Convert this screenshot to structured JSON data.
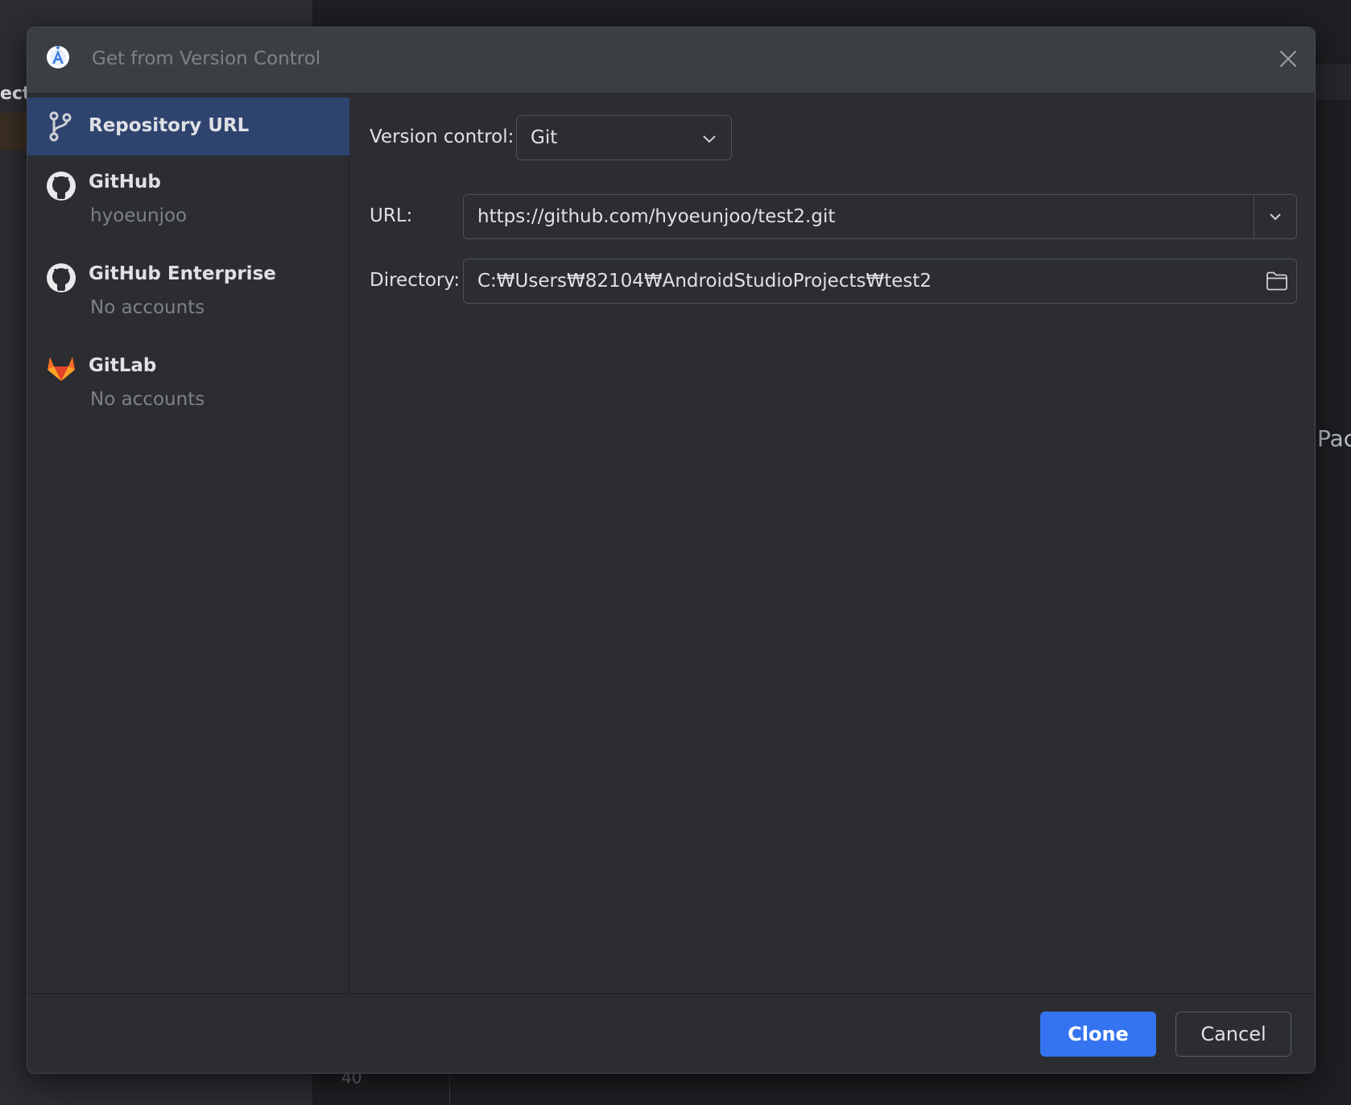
{
  "background": {
    "left_fragment": "ect",
    "right_fragment": "Pac",
    "line_number": "40"
  },
  "dialog": {
    "title": "Get from Version Control"
  },
  "sidebar": {
    "items": [
      {
        "label": "Repository URL",
        "sub": ""
      },
      {
        "label": "GitHub",
        "sub": "hyoeunjoo"
      },
      {
        "label": "GitHub Enterprise",
        "sub": "No accounts"
      },
      {
        "label": "GitLab",
        "sub": "No accounts"
      }
    ]
  },
  "form": {
    "version_control_label": "Version control:",
    "version_control_value": "Git",
    "url_label": "URL:",
    "url_value": "https://github.com/hyoeunjoo/test2.git",
    "directory_label": "Directory:",
    "directory_value": "C:₩Users₩82104₩AndroidStudioProjects₩test2"
  },
  "footer": {
    "clone_label": "Clone",
    "cancel_label": "Cancel"
  },
  "colors": {
    "accent": "#3574f0",
    "selection": "#2e436e",
    "gitlab": "#e24329"
  }
}
